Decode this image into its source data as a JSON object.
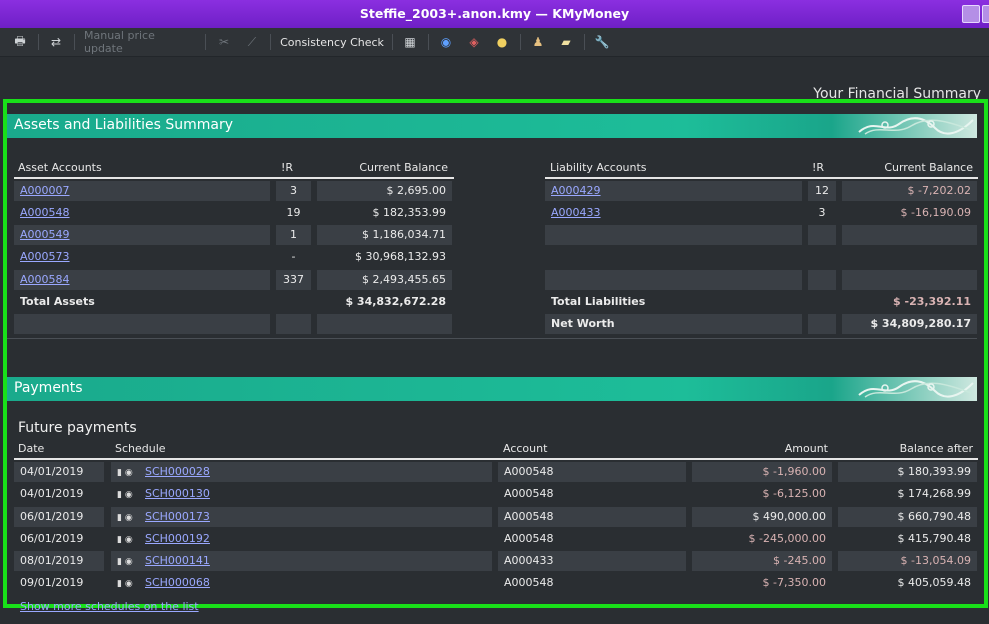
{
  "window": {
    "title": "Steffie_2003+.anon.kmy — KMyMoney"
  },
  "toolbar": {
    "manual_price_update": "Manual price update",
    "consistency_check": "Consistency Check"
  },
  "summary_title": "Your Financial Summary",
  "assets_section": {
    "title": "Assets and Liabilities Summary",
    "asset_headers": {
      "name": "Asset Accounts",
      "ir": "!R",
      "balance": "Current Balance"
    },
    "assets": [
      {
        "name": "A000007",
        "ir": "3",
        "balance": "$ 2,695.00"
      },
      {
        "name": "A000548",
        "ir": "19",
        "balance": "$ 182,353.99"
      },
      {
        "name": "A000549",
        "ir": "1",
        "balance": "$ 1,186,034.71"
      },
      {
        "name": "A000573",
        "ir": "-",
        "balance": "$ 30,968,132.93"
      },
      {
        "name": "A000584",
        "ir": "337",
        "balance": "$ 2,493,455.65"
      }
    ],
    "total_assets_label": "Total Assets",
    "total_assets_value": "$ 34,832,672.28",
    "liability_headers": {
      "name": "Liability Accounts",
      "ir": "!R",
      "balance": "Current Balance"
    },
    "liabilities": [
      {
        "name": "A000429",
        "ir": "12",
        "balance": "$ -7,202.02"
      },
      {
        "name": "A000433",
        "ir": "3",
        "balance": "$ -16,190.09"
      }
    ],
    "total_liabilities_label": "Total Liabilities",
    "total_liabilities_value": "$ -23,392.11",
    "net_worth_label": "Net Worth",
    "net_worth_value": "$ 34,809,280.17"
  },
  "payments_section": {
    "title": "Payments",
    "future_label": "Future payments",
    "headers": {
      "date": "Date",
      "schedule": "Schedule",
      "account": "Account",
      "amount": "Amount",
      "balance": "Balance after"
    },
    "rows": [
      {
        "date": "04/01/2019",
        "schedule": "SCH000028",
        "account": "A000548",
        "amount": "$ -1,960.00",
        "balance": "$ 180,393.99"
      },
      {
        "date": "04/01/2019",
        "schedule": "SCH000130",
        "account": "A000548",
        "amount": "$ -6,125.00",
        "balance": "$ 174,268.99"
      },
      {
        "date": "06/01/2019",
        "schedule": "SCH000173",
        "account": "A000548",
        "amount": "$ 490,000.00",
        "balance": "$ 660,790.48"
      },
      {
        "date": "06/01/2019",
        "schedule": "SCH000192",
        "account": "A000548",
        "amount": "$ -245,000.00",
        "balance": "$ 415,790.48"
      },
      {
        "date": "08/01/2019",
        "schedule": "SCH000141",
        "account": "A000433",
        "amount": "$ -245.00",
        "balance": "$ -13,054.09"
      },
      {
        "date": "09/01/2019",
        "schedule": "SCH000068",
        "account": "A000548",
        "amount": "$ -7,350.00",
        "balance": "$ 405,059.48"
      }
    ],
    "more_link": "Show more schedules on the list"
  },
  "colors": {
    "accent": "#1dbd99",
    "highlight_frame": "#19e019",
    "title_bar": "#7a25d4"
  }
}
